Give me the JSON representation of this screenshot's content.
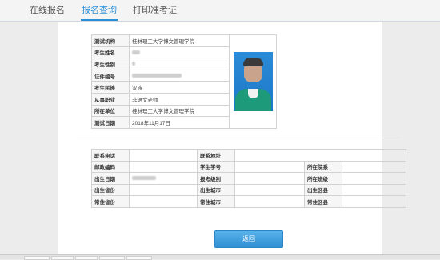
{
  "tabs": [
    "在线报名",
    "报名查询",
    "打印准考证"
  ],
  "active_tab": 1,
  "info": {
    "rows": [
      {
        "label": "测试机构",
        "value": "桂林理工大学博文管理学院"
      },
      {
        "label": "考生姓名",
        "value": ""
      },
      {
        "label": "考生性别",
        "value": ""
      },
      {
        "label": "证件编号",
        "value": ""
      },
      {
        "label": "考生民族",
        "value": "汉族"
      },
      {
        "label": "从事职业",
        "value": "非语文老师"
      },
      {
        "label": "所在单位",
        "value": "桂林理工大学博文管理学院"
      },
      {
        "label": "测试日期",
        "value": "2018年11月17日"
      }
    ]
  },
  "extra": {
    "contact_phone": "联系电话",
    "contact_address": "联系地址",
    "postal_code": "邮政编码",
    "student_number": "学生学号",
    "department": "所在院系",
    "birth_date": "出生日期",
    "exam_level": "报考级别",
    "class": "所在班级",
    "birth_province": "出生省份",
    "birth_city": "出生城市",
    "birth_district": "出生区县",
    "res_province": "常住省份",
    "res_city": "常住城市",
    "res_district": "常住区县"
  },
  "buttons": {
    "back": "返回"
  }
}
